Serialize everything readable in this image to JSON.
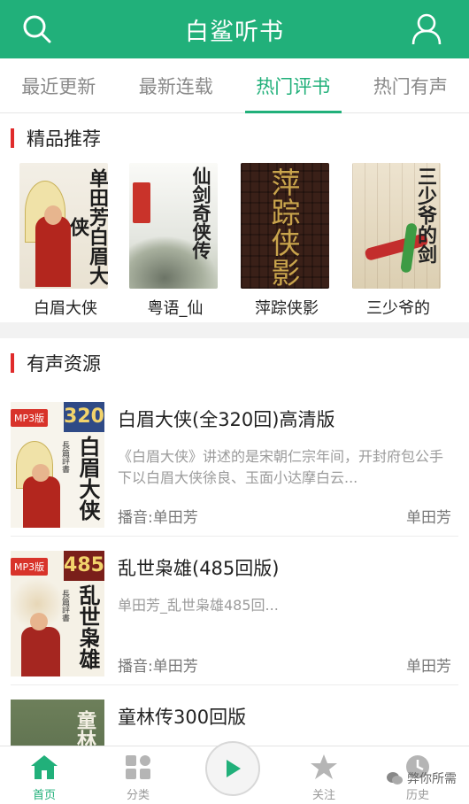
{
  "header": {
    "title": "白鲨听书",
    "search_icon": "search-icon",
    "user_icon": "user-icon",
    "bg": "#21b07a"
  },
  "tabs": [
    {
      "label": "最近更新",
      "active": false
    },
    {
      "label": "最新连载",
      "active": false
    },
    {
      "label": "热门评书",
      "active": true
    },
    {
      "label": "热门有声",
      "active": false
    }
  ],
  "featured": {
    "heading": "精品推荐",
    "items": [
      {
        "label": "白眉大侠",
        "cover_text": "单田芳白眉大侠"
      },
      {
        "label": "粤语_仙",
        "cover_text": "仙剑奇侠传"
      },
      {
        "label": "萍踪侠影",
        "cover_text": "萍踪侠影"
      },
      {
        "label": "三少爷的",
        "cover_text": "三少爷的剑"
      }
    ]
  },
  "audio": {
    "heading": "有声资源",
    "items": [
      {
        "title": "白眉大侠(全320回)高清版",
        "desc": "《白眉大侠》讲述的是宋朝仁宗年间，开封府包公手下以白眉大侠徐良、玉面小达摩白云...",
        "narrator": "播音:单田芳",
        "author": "单田芳",
        "badge_mp3": "MP3版",
        "badge_num": "320",
        "cover_title": "白眉大侠",
        "cover_sub": "長篇評書"
      },
      {
        "title": "乱世枭雄(485回版)",
        "desc": "单田芳_乱世枭雄485回...",
        "narrator": "播音:单田芳",
        "author": "单田芳",
        "badge_mp3": "MP3版",
        "badge_num": "485",
        "cover_title": "乱世枭雄",
        "cover_sub": "長篇評書"
      },
      {
        "title": "童林传300回版",
        "desc": "",
        "narrator": "",
        "author": "",
        "cover_title": "童林"
      }
    ]
  },
  "bottom_nav": {
    "items": [
      {
        "label": "首页",
        "icon": "home-icon",
        "active": true
      },
      {
        "label": "分类",
        "icon": "category-icon",
        "active": false
      },
      {
        "label": "关注",
        "icon": "star-icon",
        "active": false
      },
      {
        "label": "历史",
        "icon": "history-icon",
        "active": false
      }
    ],
    "play_icon": "play-icon"
  },
  "watermark": "弊你所需"
}
